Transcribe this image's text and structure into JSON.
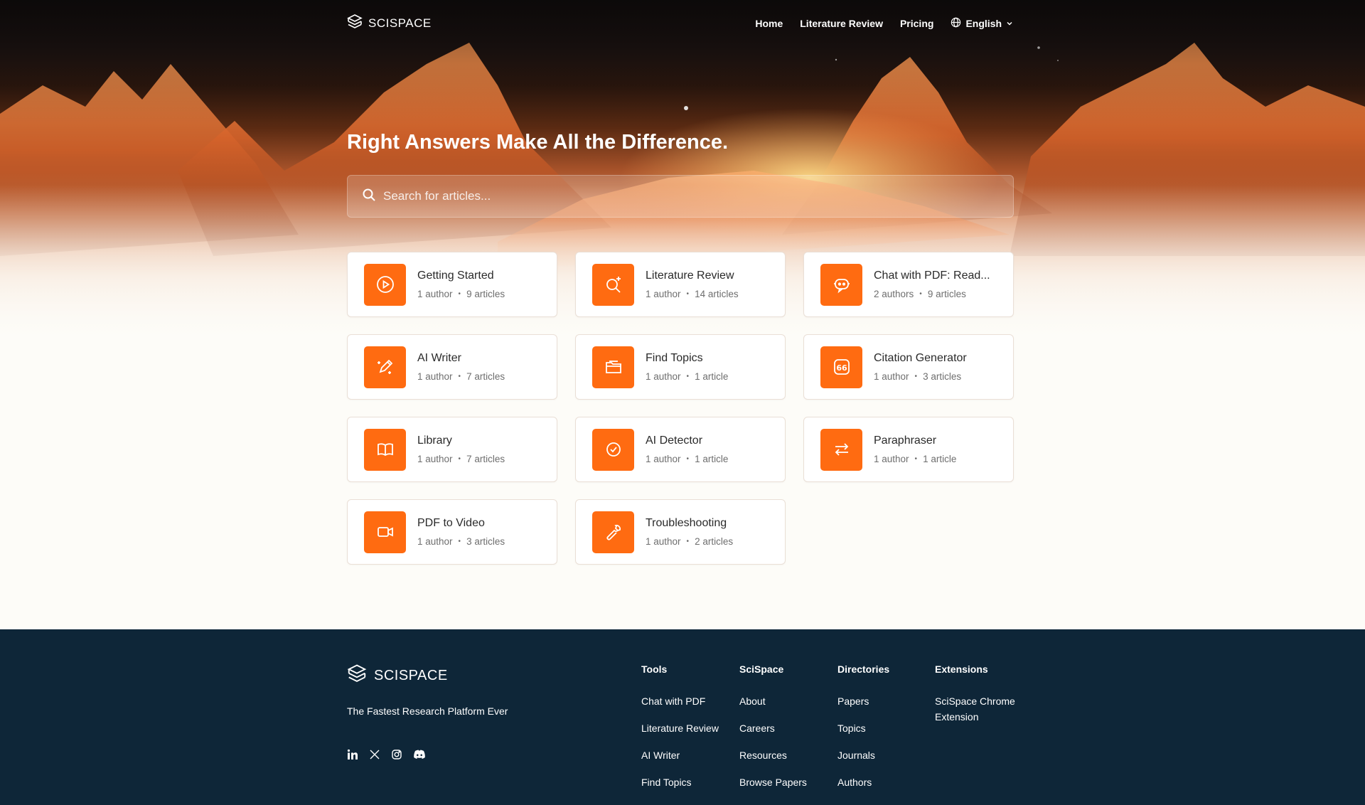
{
  "brand": {
    "name": "SCISPACE"
  },
  "nav": {
    "links": [
      "Home",
      "Literature Review",
      "Pricing"
    ],
    "language": "English"
  },
  "hero": {
    "headline": "Right Answers Make All the Difference.",
    "search_placeholder": "Search for articles..."
  },
  "collections": [
    {
      "title": "Getting Started",
      "authors": "1 author",
      "articles": "9 articles",
      "icon": "play-circle-icon"
    },
    {
      "title": "Literature Review",
      "authors": "1 author",
      "articles": "14 articles",
      "icon": "magnify-sparkle-icon"
    },
    {
      "title": "Chat with PDF: Read...",
      "authors": "2 authors",
      "articles": "9 articles",
      "icon": "chat-bot-icon"
    },
    {
      "title": "AI Writer",
      "authors": "1 author",
      "articles": "7 articles",
      "icon": "pencil-sparkle-icon"
    },
    {
      "title": "Find Topics",
      "authors": "1 author",
      "articles": "1 article",
      "icon": "folder-icon"
    },
    {
      "title": "Citation Generator",
      "authors": "1 author",
      "articles": "3 articles",
      "icon": "quote-icon"
    },
    {
      "title": "Library",
      "authors": "1 author",
      "articles": "7 articles",
      "icon": "book-icon"
    },
    {
      "title": "AI Detector",
      "authors": "1 author",
      "articles": "1 article",
      "icon": "check-circle-icon"
    },
    {
      "title": "Paraphraser",
      "authors": "1 author",
      "articles": "1 article",
      "icon": "swap-arrows-icon"
    },
    {
      "title": "PDF to Video",
      "authors": "1 author",
      "articles": "3 articles",
      "icon": "video-camera-icon"
    },
    {
      "title": "Troubleshooting",
      "authors": "1 author",
      "articles": "2 articles",
      "icon": "wrench-icon"
    }
  ],
  "footer": {
    "tagline": "The Fastest Research Platform Ever",
    "social": [
      "linkedin-icon",
      "x-icon",
      "instagram-icon",
      "discord-icon"
    ],
    "columns": [
      {
        "title": "Tools",
        "links": [
          "Chat with PDF",
          "Literature Review",
          "AI Writer",
          "Find Topics"
        ]
      },
      {
        "title": "SciSpace",
        "links": [
          "About",
          "Careers",
          "Resources",
          "Browse Papers"
        ]
      },
      {
        "title": "Directories",
        "links": [
          "Papers",
          "Topics",
          "Journals",
          "Authors"
        ]
      },
      {
        "title": "Extensions",
        "links": [
          "SciSpace Chrome Extension"
        ]
      }
    ]
  },
  "colors": {
    "accent": "#ff6b11",
    "footer_bg": "#0e2638",
    "page_bg": "#fdfcf8"
  }
}
